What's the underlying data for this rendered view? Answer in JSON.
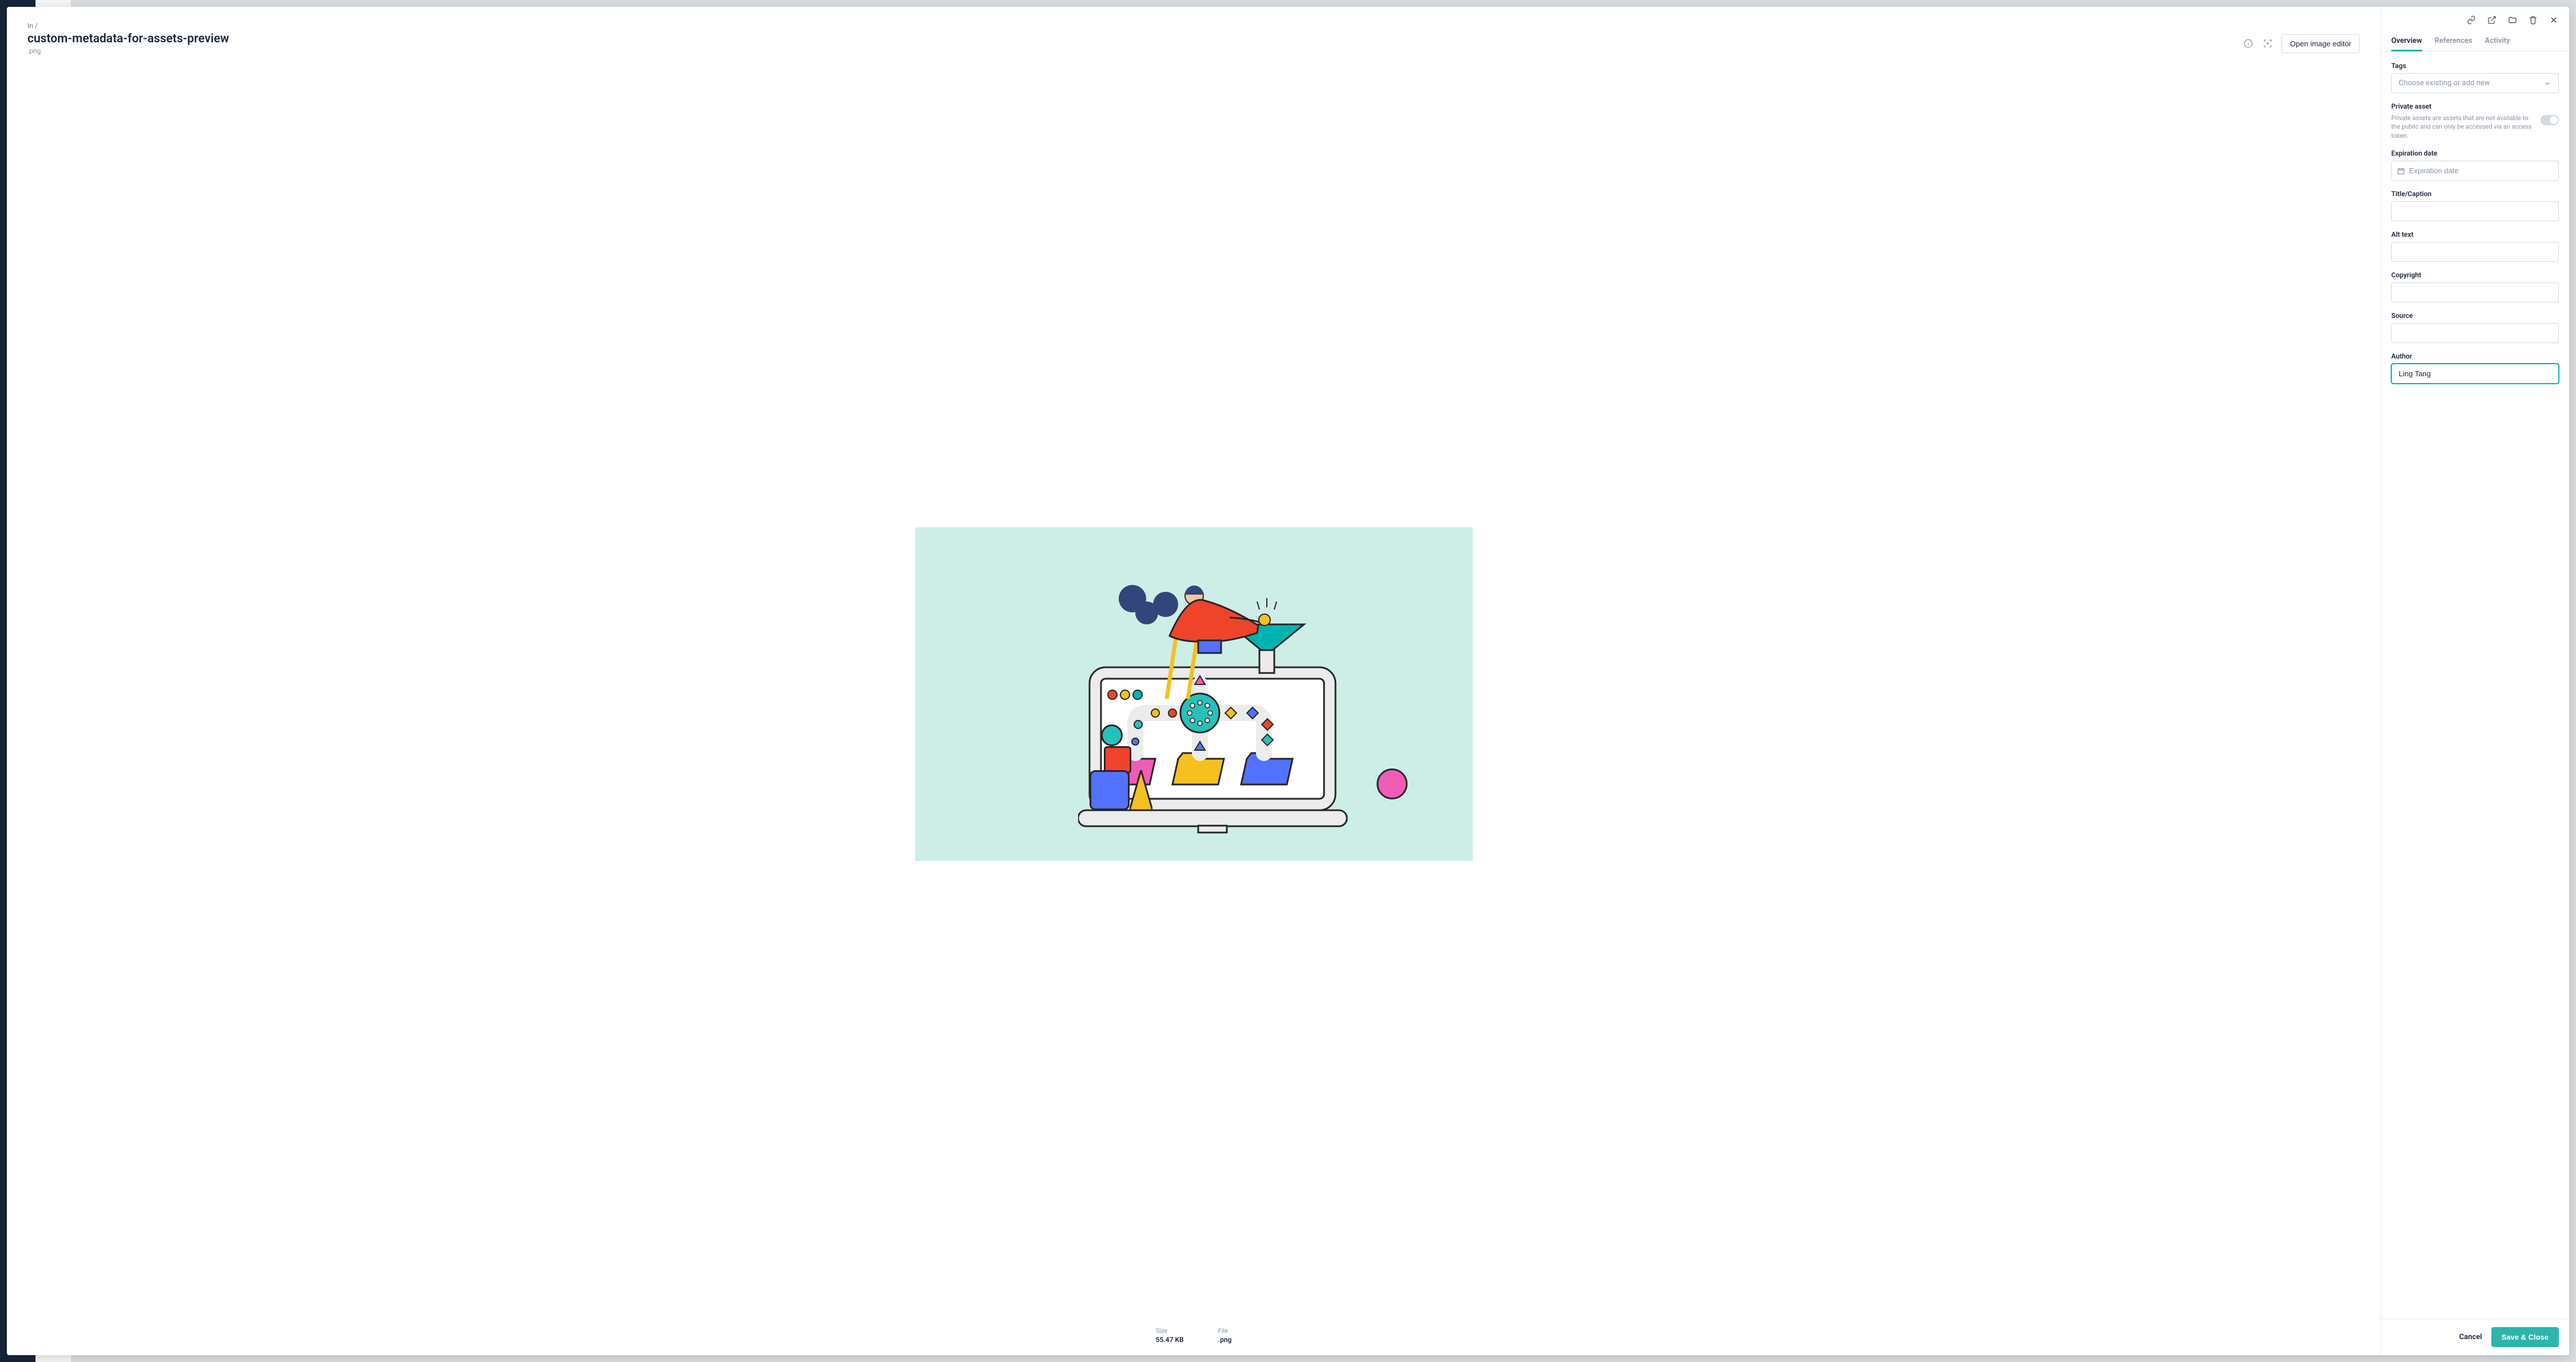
{
  "breadcrumb": {
    "prefix": "In",
    "sep": "/"
  },
  "asset": {
    "title": "custom-metadata-for-assets-preview",
    "extension": ".png"
  },
  "header": {
    "open_editor_label": "Open image editor"
  },
  "meta": {
    "size_label": "Size",
    "size_value": "55.47 KB",
    "file_label": "File",
    "file_value": ".png"
  },
  "panel": {
    "tabs": [
      {
        "label": "Overview",
        "active": true
      },
      {
        "label": "References",
        "active": false
      },
      {
        "label": "Activity",
        "active": false
      }
    ],
    "tags": {
      "label": "Tags",
      "placeholder": "Choose existing or add new"
    },
    "private": {
      "label": "Private asset",
      "helper": "Private assets are assets that are not available to the public and can only be accessed via an access token.",
      "enabled": false
    },
    "expiration": {
      "label": "Expiration date",
      "placeholder": "Expiration date",
      "value": ""
    },
    "title_caption": {
      "label": "Title/Caption",
      "value": ""
    },
    "alt_text": {
      "label": "Alt text",
      "value": ""
    },
    "copyright": {
      "label": "Copyright",
      "value": ""
    },
    "source": {
      "label": "Source",
      "value": ""
    },
    "author": {
      "label": "Author",
      "value": "Ling Tang"
    },
    "footer": {
      "cancel_label": "Cancel",
      "save_label": "Save & Close"
    }
  },
  "colors": {
    "accent": "#00b3b0",
    "stage_bg": "#cdeee7"
  }
}
